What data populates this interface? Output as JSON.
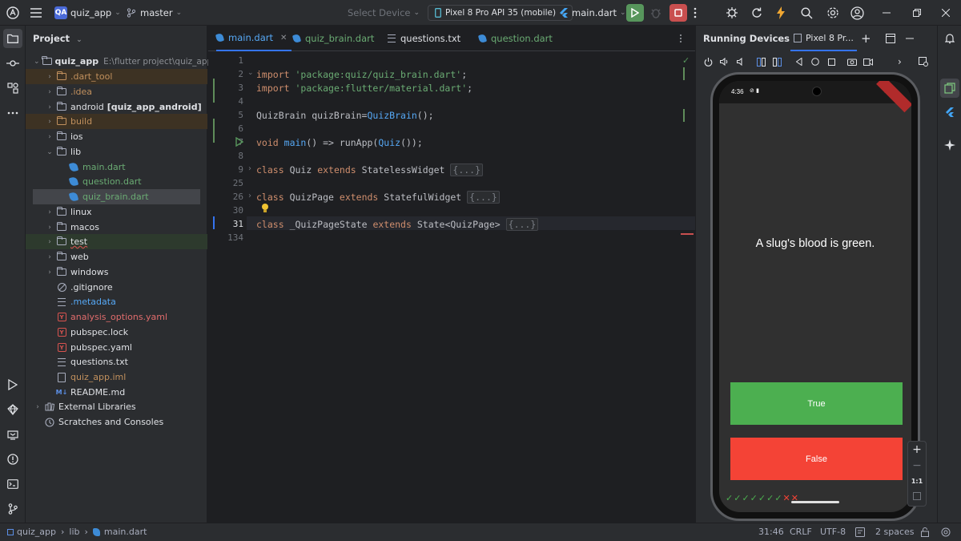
{
  "titlebar": {
    "project_badge": "QA",
    "project_name": "quiz_app",
    "branch": "master",
    "select_device": "Select Device",
    "device": "Pixel 8 Pro API 35 (mobile)",
    "run_config": "main.dart"
  },
  "project_panel": {
    "title": "Project",
    "root_name": "quiz_app",
    "root_path": "E:\\flutter project\\quiz_app",
    "items": [
      {
        "label": ".dart_tool",
        "kind": "folder-brown",
        "color": "#c1905d"
      },
      {
        "label": ".idea",
        "kind": "folder",
        "color": "#c1905d"
      },
      {
        "label": "android",
        "suffix": "[quiz_app_android]",
        "kind": "folder",
        "color": "#dfe1e5"
      },
      {
        "label": "build",
        "kind": "folder-brown",
        "color": "#c1905d"
      },
      {
        "label": "ios",
        "kind": "folder",
        "color": "#dfe1e5"
      },
      {
        "label": "lib",
        "kind": "folder",
        "color": "#dfe1e5"
      },
      {
        "label": "main.dart",
        "kind": "dart",
        "color": "#6aab73"
      },
      {
        "label": "question.dart",
        "kind": "dart",
        "color": "#6aab73"
      },
      {
        "label": "quiz_brain.dart",
        "kind": "dart",
        "color": "#6aab73"
      },
      {
        "label": "linux",
        "kind": "folder",
        "color": "#dfe1e5"
      },
      {
        "label": "macos",
        "kind": "folder",
        "color": "#dfe1e5"
      },
      {
        "label": "test",
        "kind": "folder",
        "color": "#dfe1e5"
      },
      {
        "label": "web",
        "kind": "folder",
        "color": "#dfe1e5"
      },
      {
        "label": "windows",
        "kind": "folder",
        "color": "#dfe1e5"
      },
      {
        "label": ".gitignore",
        "kind": "ignore",
        "color": "#dfe1e5"
      },
      {
        "label": ".metadata",
        "kind": "text",
        "color": "#56a8f5"
      },
      {
        "label": "analysis_options.yaml",
        "kind": "yaml",
        "color": "#e06c6c"
      },
      {
        "label": "pubspec.lock",
        "kind": "yaml",
        "color": "#dfe1e5"
      },
      {
        "label": "pubspec.yaml",
        "kind": "yaml",
        "color": "#dfe1e5"
      },
      {
        "label": "questions.txt",
        "kind": "text",
        "color": "#dfe1e5"
      },
      {
        "label": "quiz_app.iml",
        "kind": "file",
        "color": "#c1905d"
      },
      {
        "label": "README.md",
        "kind": "md",
        "color": "#dfe1e5"
      }
    ],
    "external_libraries": "External Libraries",
    "scratches": "Scratches and Consoles"
  },
  "editor": {
    "tabs": [
      {
        "label": "main.dart",
        "active": true
      },
      {
        "label": "quiz_brain.dart",
        "active": false
      },
      {
        "label": "questions.txt",
        "active": false
      },
      {
        "label": "question.dart",
        "active": false
      }
    ],
    "line_numbers": [
      "1",
      "2",
      "3",
      "4",
      "5",
      "6",
      "7",
      "8",
      "9",
      "25",
      "26",
      "30",
      "31",
      "134"
    ],
    "code": {
      "l2_kw": "import",
      "l2_str": "'package:quiz/quiz_brain.dart'",
      "l3_kw": "import",
      "l3_str": "'package:flutter/material.dart'",
      "semicolon": ";",
      "l5_a": "QuizBrain quizBrain=",
      "l5_fn": "QuizBrain",
      "l5_b": "();",
      "l7_kw": "void",
      "l7_fn": "main",
      "l7_a": "() => runApp(",
      "l7_fn2": "Quiz",
      "l7_b": "());",
      "class_kw": "class",
      "extends_kw": "extends",
      "l9_name": "Quiz",
      "l9_base": "StatelessWidget",
      "l26_name": "QuizPage",
      "l26_base": "StatefulWidget",
      "l31_name": "_QuizPageState",
      "l31_base": "State<QuizPage>",
      "folded": "{...}"
    }
  },
  "devices": {
    "title": "Running Devices",
    "device_tab": "Pixel 8 Pr...",
    "status_time": "4:36",
    "question": "A slug's blood is green.",
    "true_label": "True",
    "false_label": "False",
    "true_color": "#4caf50",
    "false_color": "#f44336",
    "score": [
      "check",
      "check",
      "check",
      "check",
      "check",
      "check",
      "check",
      "cross",
      "cross"
    ],
    "zoom_label": "1:1"
  },
  "statusbar": {
    "breadcrumb": [
      "quiz_app",
      "lib",
      "main.dart"
    ],
    "position": "31:46",
    "line_sep": "CRLF",
    "encoding": "UTF-8",
    "indent": "2 spaces"
  }
}
